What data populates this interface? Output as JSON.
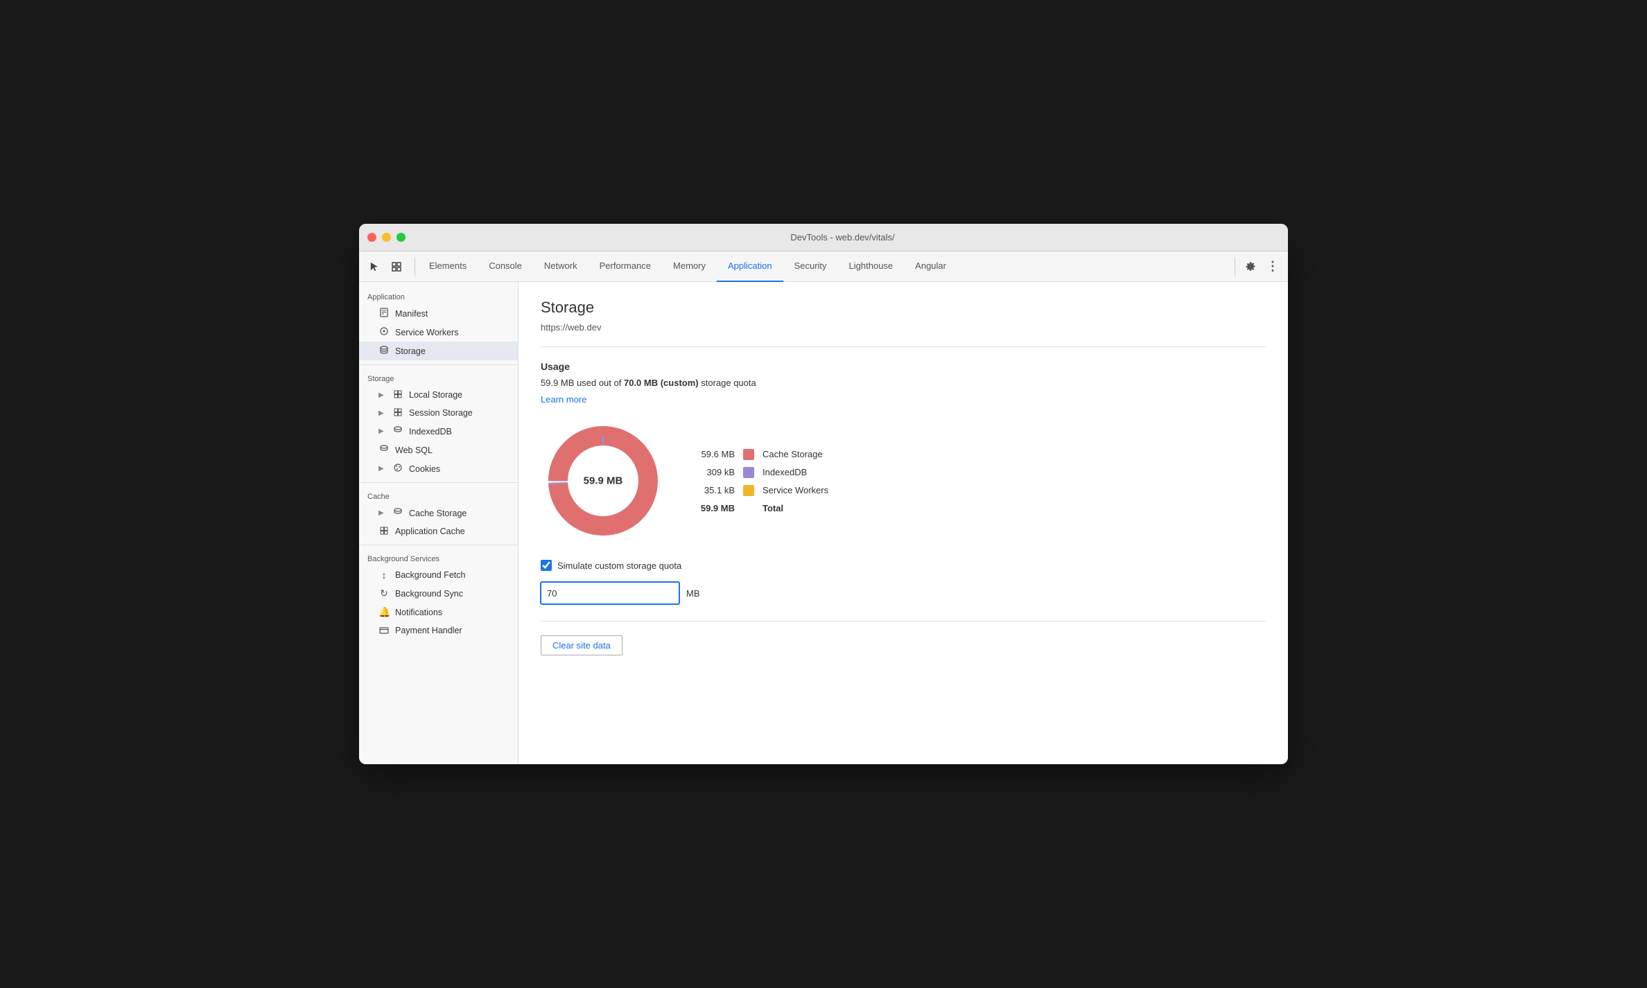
{
  "window": {
    "title": "DevTools - web.dev/vitals/"
  },
  "toolbar": {
    "cursor_icon": "⬡",
    "tabs": [
      {
        "id": "elements",
        "label": "Elements",
        "active": false
      },
      {
        "id": "console",
        "label": "Console",
        "active": false
      },
      {
        "id": "network",
        "label": "Network",
        "active": false
      },
      {
        "id": "performance",
        "label": "Performance",
        "active": false
      },
      {
        "id": "memory",
        "label": "Memory",
        "active": false
      },
      {
        "id": "application",
        "label": "Application",
        "active": true
      },
      {
        "id": "security",
        "label": "Security",
        "active": false
      },
      {
        "id": "lighthouse",
        "label": "Lighthouse",
        "active": false
      },
      {
        "id": "angular",
        "label": "Angular",
        "active": false
      }
    ],
    "settings_label": "⚙",
    "more_label": "⋮"
  },
  "sidebar": {
    "sections": [
      {
        "header": "Application",
        "items": [
          {
            "id": "manifest",
            "label": "Manifest",
            "icon": "📄",
            "indent": 1,
            "active": false
          },
          {
            "id": "service-workers",
            "label": "Service Workers",
            "icon": "⚙",
            "indent": 1,
            "active": false
          },
          {
            "id": "storage",
            "label": "Storage",
            "icon": "🗄",
            "indent": 1,
            "active": true
          }
        ]
      },
      {
        "header": "Storage",
        "items": [
          {
            "id": "local-storage",
            "label": "Local Storage",
            "icon": "⊞",
            "indent": 1,
            "arrow": true,
            "active": false
          },
          {
            "id": "session-storage",
            "label": "Session Storage",
            "icon": "⊞",
            "indent": 1,
            "arrow": true,
            "active": false
          },
          {
            "id": "indexeddb",
            "label": "IndexedDB",
            "icon": "🗄",
            "indent": 1,
            "arrow": true,
            "active": false
          },
          {
            "id": "web-sql",
            "label": "Web SQL",
            "icon": "🗄",
            "indent": 1,
            "active": false
          },
          {
            "id": "cookies",
            "label": "Cookies",
            "icon": "🍪",
            "indent": 1,
            "arrow": true,
            "active": false
          }
        ]
      },
      {
        "header": "Cache",
        "items": [
          {
            "id": "cache-storage",
            "label": "Cache Storage",
            "icon": "🗄",
            "indent": 1,
            "arrow": true,
            "active": false
          },
          {
            "id": "application-cache",
            "label": "Application Cache",
            "icon": "⊞",
            "indent": 1,
            "active": false
          }
        ]
      },
      {
        "header": "Background Services",
        "items": [
          {
            "id": "background-fetch",
            "label": "Background Fetch",
            "icon": "↕",
            "indent": 1,
            "active": false
          },
          {
            "id": "background-sync",
            "label": "Background Sync",
            "icon": "↻",
            "indent": 1,
            "active": false
          },
          {
            "id": "notifications",
            "label": "Notifications",
            "icon": "🔔",
            "indent": 1,
            "active": false
          },
          {
            "id": "payment-handler",
            "label": "Payment Handler",
            "icon": "💳",
            "indent": 1,
            "active": false
          }
        ]
      }
    ]
  },
  "content": {
    "title": "Storage",
    "url": "https://web.dev",
    "usage": {
      "label": "Usage",
      "description_prefix": "59.9 MB used out of ",
      "quota_bold": "70.0 MB (custom)",
      "description_suffix": " storage quota",
      "learn_more": "Learn more"
    },
    "chart": {
      "center_label": "59.9 MB",
      "legend": [
        {
          "value": "59.6 MB",
          "color": "#e07070",
          "label": "Cache Storage",
          "bold": false
        },
        {
          "value": "309 kB",
          "color": "#9b88d4",
          "label": "IndexedDB",
          "bold": false
        },
        {
          "value": "35.1 kB",
          "color": "#f0b429",
          "label": "Service Workers",
          "bold": false
        },
        {
          "value": "59.9 MB",
          "color": null,
          "label": "Total",
          "bold": true
        }
      ]
    },
    "simulate_checkbox": {
      "checked": true,
      "label": "Simulate custom storage quota"
    },
    "quota_input": {
      "value": "70",
      "unit": "MB"
    },
    "clear_button": "Clear site data"
  },
  "colors": {
    "accent": "#1a73e8",
    "cache_storage": "#e07070",
    "indexed_db": "#9b88d4",
    "service_workers": "#f0b429",
    "donut_gap": "#6b9fff"
  }
}
